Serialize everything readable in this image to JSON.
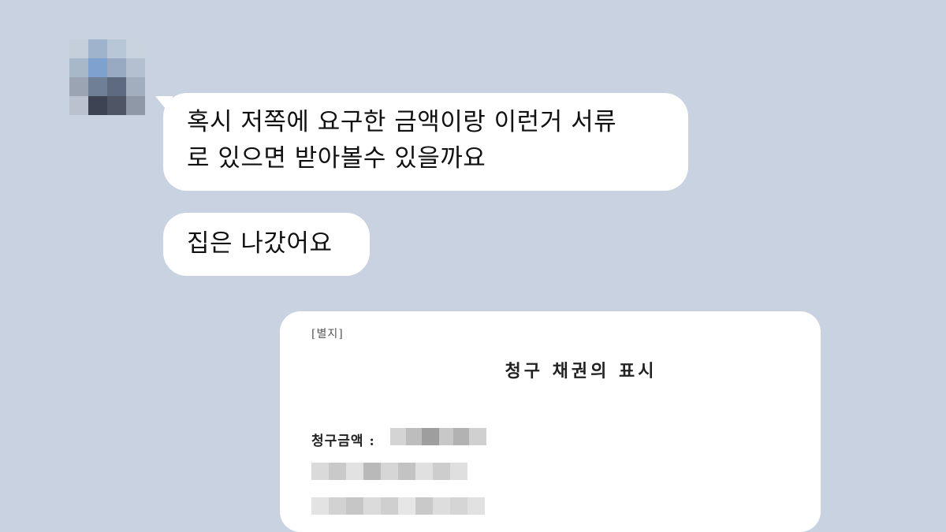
{
  "messages": [
    {
      "lines": [
        "혹시 저쪽에 요구한 금액이랑 이런거 서류",
        "로 있으면 받아볼수 있을까요"
      ]
    },
    {
      "lines": [
        "집은 나갔어요"
      ]
    }
  ],
  "document": {
    "tag": "[별지]",
    "title": "청구 채권의 표시",
    "amount_label": "청구금액 :"
  },
  "colors": {
    "background": "#c8d2e0",
    "bubble": "#ffffff"
  }
}
